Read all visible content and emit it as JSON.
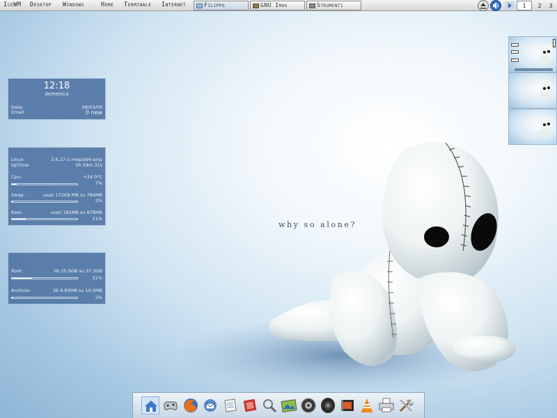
{
  "taskbar": {
    "menu": [
      "IceWM",
      "Desktop",
      "Windows",
      "Home",
      "Terminale",
      "Internet"
    ],
    "tasks": [
      {
        "label": "Filippo",
        "active": true
      },
      {
        "label": "GNU Imag",
        "active": false
      },
      {
        "label": "Strumenti",
        "active": false
      }
    ],
    "workspaces": [
      "1",
      "2",
      "3"
    ],
    "active_workspace": "1"
  },
  "clock_widget": {
    "time": "12:18",
    "day": "domenica",
    "date_label": "Date:",
    "date_value": "08/03/09",
    "email_label": "Email",
    "email_value": "0 new"
  },
  "system_widget": {
    "os_label": "Linux:",
    "os_value": "2.6.27-1-mepis64-smp",
    "uptime_label": "UpTime:",
    "uptime_value": "0h 24m 31s",
    "cpu_label": "Cpu:",
    "cpu_temp": "+34.0°C",
    "cpu_percent": "7%",
    "cpu_fill": 0.07,
    "swap_label": "Swap:",
    "swap_value": "usati 172KB MB  su 784MB",
    "swap_percent": "2%",
    "swap_fill": 0.02,
    "ram_label": "Ram:",
    "ram_value": "usati 181MB  su 878MB",
    "ram_percent": "21%",
    "ram_fill": 0.21
  },
  "disk_widget": {
    "root_label": "Root:",
    "root_value": "lib 25.9GB su 37.3GB",
    "root_percent": "31%",
    "root_fill": 0.31,
    "archive_label": "Archivio:",
    "archive_value": "lib 9.83MB su 10.0MB",
    "archive_percent": "2%",
    "archive_fill": 0.02
  },
  "wallpaper": {
    "tagline": "why so alone?"
  },
  "dock": {
    "icons": [
      "home-icon",
      "games-icon",
      "firefox-icon",
      "thunderbird-icon",
      "text-editor-icon",
      "gimp-icon",
      "search-icon",
      "image-viewer-icon",
      "cd-burner-icon",
      "speaker-icon",
      "video-icon",
      "vlc-icon",
      "printer-icon",
      "tools-icon"
    ]
  },
  "colors": {
    "widget_bg": "#5275a4",
    "widget_text": "#eaf2fb",
    "panel_bg": "#e6e6e6",
    "desktop_blue": "#9fc2de"
  }
}
